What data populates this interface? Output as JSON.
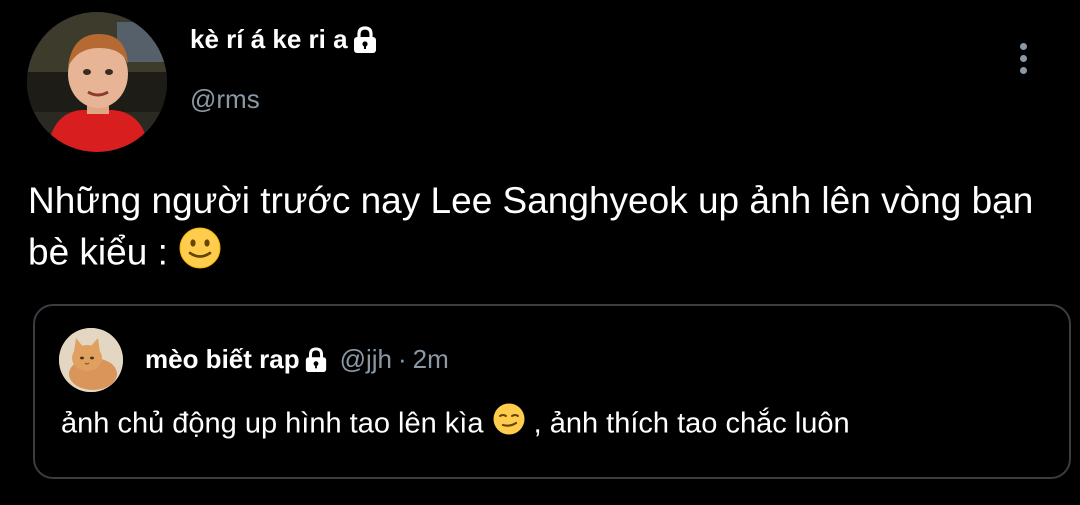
{
  "author": {
    "display_name": "kè rí á ke ri a",
    "handle": "@rms",
    "locked": true
  },
  "tweet": {
    "text_part1": "Những người trước nay Lee Sanghyeok up ảnh lên vòng bạn bè kiểu  :",
    "emoji": "slightly-smiling-face"
  },
  "quoted_tweet": {
    "display_name": "mèo biết rap",
    "handle": "@jjh",
    "separator": "·",
    "time": "2m",
    "text_part1": "ảnh chủ động up hình tao lên kìa",
    "emoji": "smirking-face",
    "text_part2": ", ảnh thích tao chắc luôn"
  },
  "colors": {
    "background": "#000000",
    "primary_text": "#ffffff",
    "secondary_text": "#8b98a5",
    "card_border": "#3a3d42"
  },
  "icons": {
    "lock": "lock-icon",
    "more": "more-vertical-icon"
  }
}
